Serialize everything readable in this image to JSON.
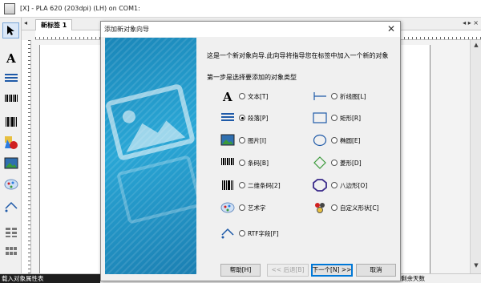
{
  "window": {
    "title": "[X] - PLA 620 (203dpi) (LH) on COM1:"
  },
  "editor": {
    "tab_label": "新标签 1",
    "tab_controls": "◂ ▸ ×",
    "tab_left": "◂"
  },
  "dialog": {
    "title": "添加新对象向导",
    "close": "✕",
    "intro": "这是一个新对象向导.此向导将指导您在标签中加入一个新的对象",
    "step": "第一步是选择要添加的对象类型",
    "options_left": [
      {
        "icon": "text-icon",
        "label": "文本[T]",
        "selected": false
      },
      {
        "icon": "paragraph-icon",
        "label": "段落[P]",
        "selected": true
      },
      {
        "icon": "picture-icon",
        "label": "图片[I]",
        "selected": false
      },
      {
        "icon": "barcode-icon",
        "label": "条码[B]",
        "selected": false
      },
      {
        "icon": "2d-barcode-icon",
        "label": "二维条码[2]",
        "selected": false
      },
      {
        "icon": "art-text-icon",
        "label": "艺术字",
        "selected": false
      },
      {
        "icon": "rtf-field-icon",
        "label": "RTF字段[F]",
        "selected": false
      }
    ],
    "options_right": [
      {
        "icon": "polyline-icon",
        "label": "折线图[L]",
        "selected": false
      },
      {
        "icon": "rectangle-icon",
        "label": "矩形[R]",
        "selected": false
      },
      {
        "icon": "ellipse-icon",
        "label": "椭圆[E]",
        "selected": false
      },
      {
        "icon": "diamond-icon",
        "label": "菱形[D]",
        "selected": false
      },
      {
        "icon": "octagon-icon",
        "label": "八边形[O]",
        "selected": false
      },
      {
        "icon": "custom-shape-icon",
        "label": "自定义形状[C]",
        "selected": false
      }
    ],
    "buttons": {
      "help": "帮助[H]",
      "back": "<< 后退[B]",
      "next": "下一个[N] >>",
      "cancel": "取消"
    }
  },
  "status": {
    "left": "载入对象属性表",
    "right": "剩余天数"
  },
  "colors": {
    "banner": "#1a86b8",
    "accent": "#0078d7",
    "icon_blue": "#1f5aa8"
  }
}
